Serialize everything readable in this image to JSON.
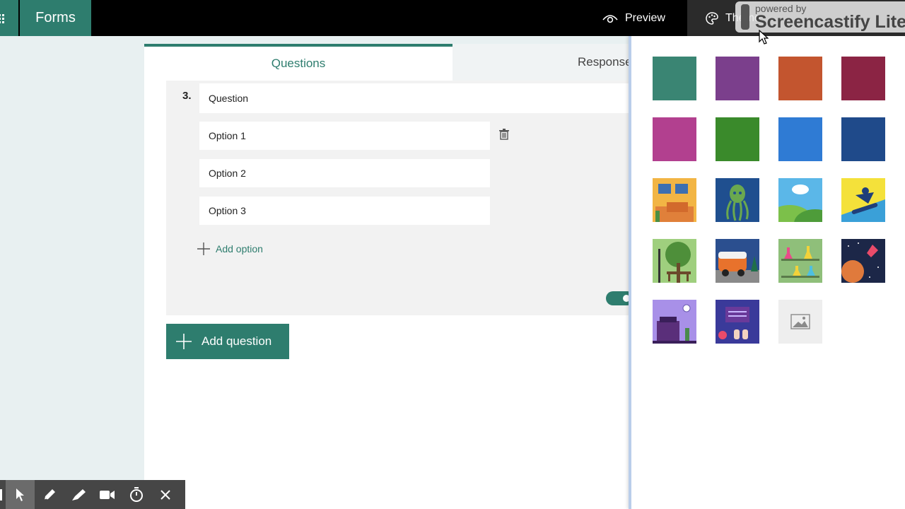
{
  "topbar": {
    "app_name": "Forms",
    "preview_label": "Preview",
    "theme_label": "Theme"
  },
  "watermark": {
    "line1": "powered by",
    "line2": "Screencastify Lite"
  },
  "tabs": {
    "questions": "Questions",
    "responses": "Responses"
  },
  "question": {
    "number": "3.",
    "text": "Question",
    "options": [
      "Option 1",
      "Option 2",
      "Option 3"
    ],
    "add_option": "Add option"
  },
  "add_question": "Add question",
  "theme_colors": [
    "#3a8573",
    "#7b3f8c",
    "#c3552f",
    "#8b2444",
    "#b2408f",
    "#3a8a2b",
    "#2f7bd4",
    "#1f4a8a"
  ],
  "theme_images": [
    "living-room",
    "octopus",
    "hills-cloud",
    "snowboarder",
    "park-bench",
    "camper-van",
    "laboratory-flasks",
    "space-rocket",
    "desk-clock",
    "classroom-board",
    "upload-image"
  ],
  "recorder_tools": [
    "cursor-icon",
    "pen-icon",
    "highlighter-icon",
    "camera-icon",
    "timer-icon",
    "close-icon"
  ]
}
